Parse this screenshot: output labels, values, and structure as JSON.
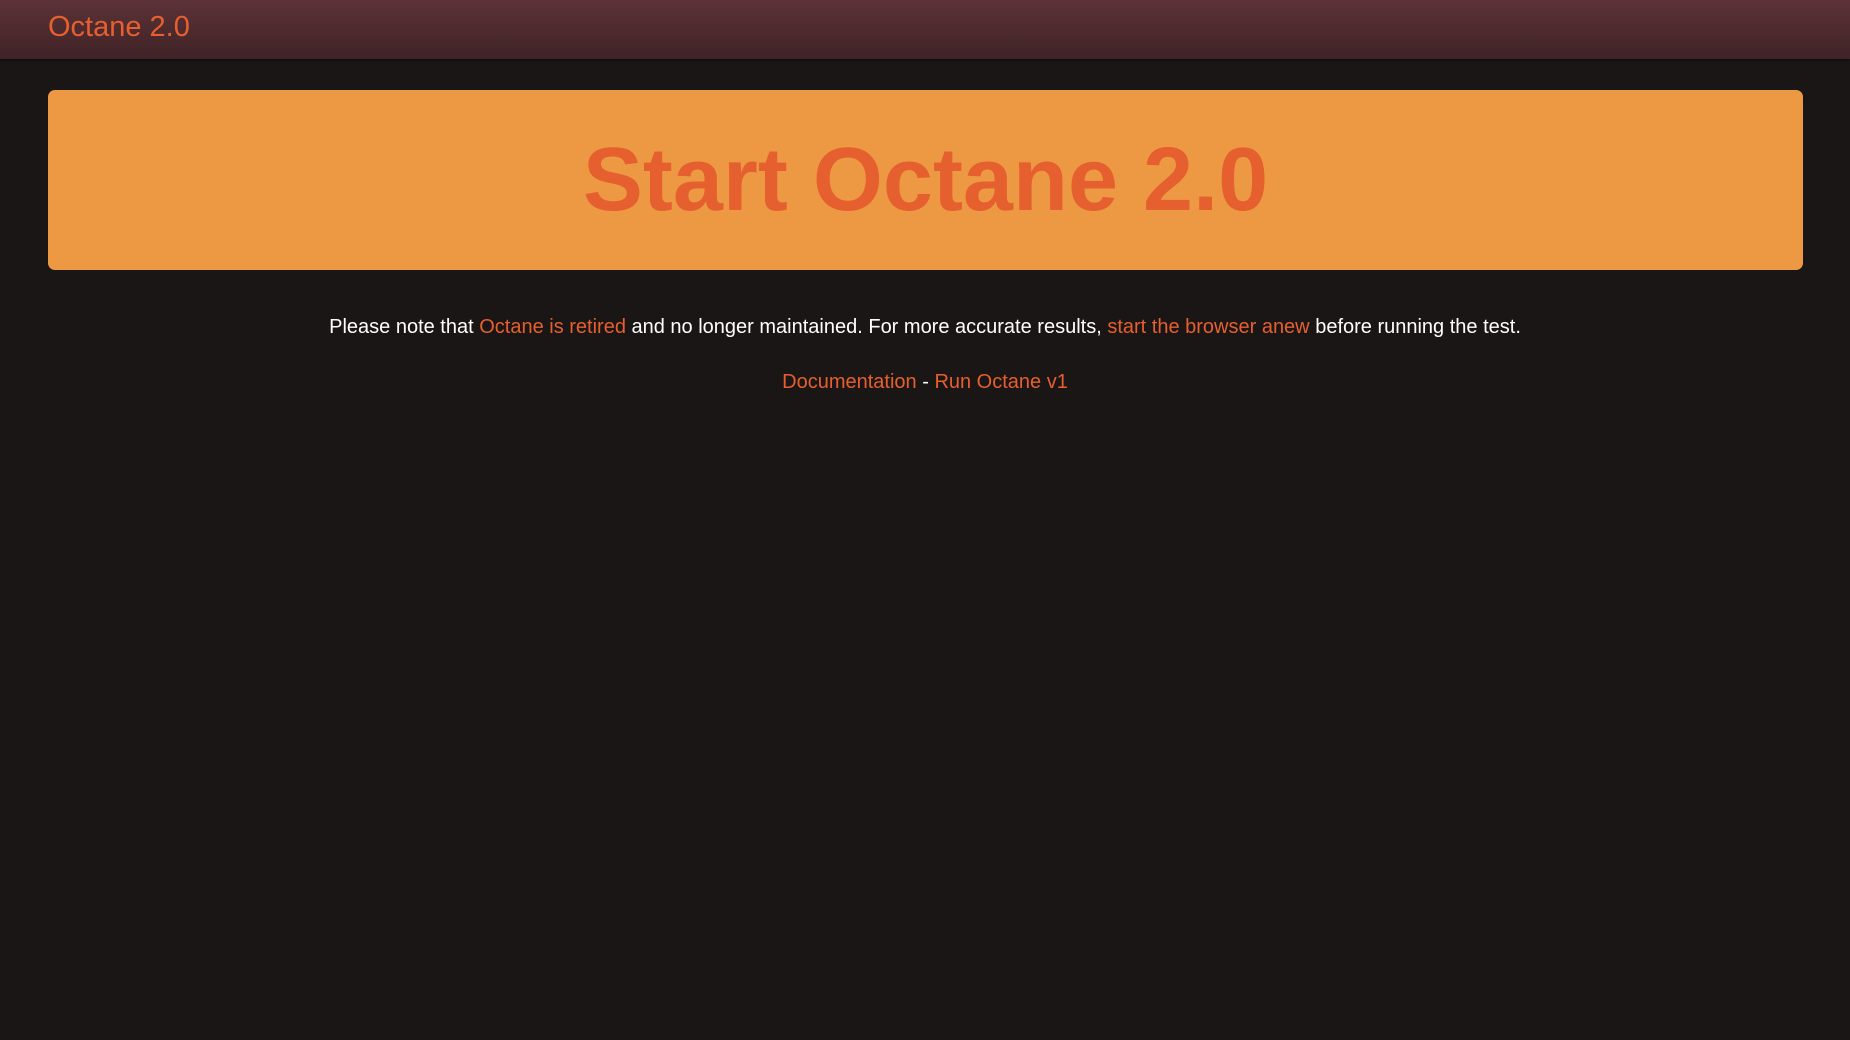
{
  "navbar": {
    "brand": "Octane 2.0"
  },
  "hero": {
    "label": "Start Octane 2.0"
  },
  "notice": {
    "prefix": "Please note that ",
    "retired_link": "Octane is retired",
    "middle": " and no longer maintained. For more accurate results, ",
    "anew_link": "start the browser anew",
    "suffix": " before running the test."
  },
  "links": {
    "documentation": "Documentation",
    "separator": " - ",
    "run_v1": "Run Octane v1"
  },
  "colors": {
    "background": "#1a1616",
    "navbar": "#4f2b2f",
    "accent": "#e65f2f",
    "hero_background": "#ed9943",
    "text": "#ffffff"
  }
}
